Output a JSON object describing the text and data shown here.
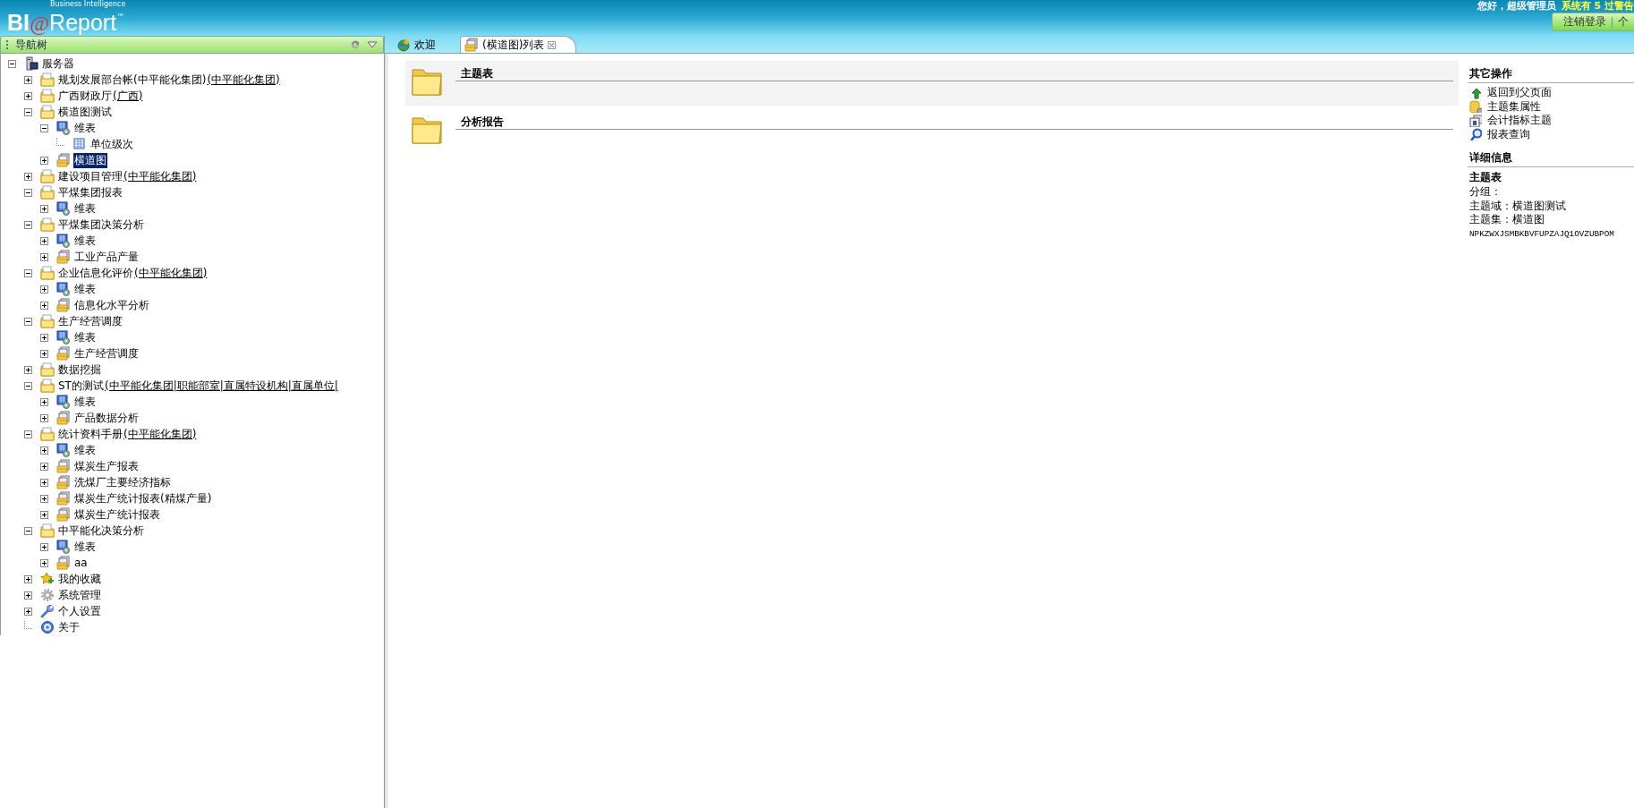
{
  "header": {
    "logo": {
      "tagline": "Business Intelligence",
      "main": "BI",
      "at": "@",
      "product": "Report",
      "tm": "™"
    },
    "greeting": "您好，超级管理员",
    "notice": "系统有 5 过警告",
    "buttons": [
      "注销登录",
      "个"
    ]
  },
  "nav": {
    "title": "导航树",
    "tree": [
      {
        "label": "服务器",
        "kind": "server",
        "expanded": true,
        "selected": false,
        "children": [
          {
            "label": "规划发展部台帐(中平能化集团)",
            "link": "(中平能化集团)",
            "kind": "folder",
            "expanded": false,
            "selected": false
          },
          {
            "label": "广西财政厅",
            "link": "(广西)",
            "kind": "folder",
            "expanded": false,
            "selected": false
          },
          {
            "label": "横道图测试",
            "kind": "folder",
            "expanded": true,
            "selected": false,
            "children": [
              {
                "label": "维表",
                "kind": "cube",
                "expanded": true,
                "selected": false,
                "children": [
                  {
                    "label": "单位级次",
                    "kind": "table",
                    "selected": false
                  }
                ]
              },
              {
                "label": "横道图",
                "kind": "report",
                "expanded": false,
                "selected": true
              }
            ]
          },
          {
            "label": "建设项目管理",
            "link": "(中平能化集团)",
            "kind": "folder",
            "expanded": false,
            "selected": false
          },
          {
            "label": "平煤集团报表",
            "kind": "folder",
            "expanded": true,
            "selected": false,
            "children": [
              {
                "label": "维表",
                "kind": "cube",
                "expanded": false,
                "selected": false
              }
            ]
          },
          {
            "label": "平煤集团决策分析",
            "kind": "folder",
            "expanded": true,
            "selected": false,
            "children": [
              {
                "label": "维表",
                "kind": "cube",
                "expanded": false,
                "selected": false
              },
              {
                "label": "工业产品产量",
                "kind": "report",
                "expanded": false,
                "selected": false
              }
            ]
          },
          {
            "label": "企业信息化评价",
            "link": "(中平能化集团)",
            "kind": "folder",
            "expanded": true,
            "selected": false,
            "children": [
              {
                "label": "维表",
                "kind": "cube",
                "expanded": false,
                "selected": false
              },
              {
                "label": "信息化水平分析",
                "kind": "report",
                "expanded": false,
                "selected": false
              }
            ]
          },
          {
            "label": "生产经营调度",
            "kind": "folder",
            "expanded": true,
            "selected": false,
            "children": [
              {
                "label": "维表",
                "kind": "cube",
                "expanded": false,
                "selected": false
              },
              {
                "label": "生产经营调度",
                "kind": "report",
                "expanded": false,
                "selected": false
              }
            ]
          },
          {
            "label": "数据挖掘",
            "kind": "folder",
            "expanded": false,
            "selected": false
          },
          {
            "label": "ST的测试",
            "link": "(中平能化集团|职能部室|直属特设机构|直属单位|",
            "kind": "folder",
            "expanded": true,
            "selected": false,
            "children": [
              {
                "label": "维表",
                "kind": "cube",
                "expanded": false,
                "selected": false
              },
              {
                "label": "产品数据分析",
                "kind": "report",
                "expanded": false,
                "selected": false
              }
            ]
          },
          {
            "label": "统计资料手册",
            "link": "(中平能化集团)",
            "kind": "folder",
            "expanded": true,
            "selected": false,
            "children": [
              {
                "label": "维表",
                "kind": "cube",
                "expanded": false,
                "selected": false
              },
              {
                "label": "煤炭生产报表",
                "kind": "report",
                "expanded": false,
                "selected": false
              },
              {
                "label": "洗煤厂主要经济指标",
                "kind": "report",
                "expanded": false,
                "selected": false
              },
              {
                "label": "煤炭生产统计报表(精煤产量)",
                "kind": "report",
                "expanded": false,
                "selected": false
              },
              {
                "label": "煤炭生产统计报表",
                "kind": "report",
                "expanded": false,
                "selected": false
              }
            ]
          },
          {
            "label": "中平能化决策分析",
            "kind": "folder",
            "expanded": true,
            "selected": false,
            "children": [
              {
                "label": "维表",
                "kind": "cube",
                "expanded": false,
                "selected": false
              },
              {
                "label": "aa",
                "kind": "report",
                "expanded": false,
                "selected": false
              }
            ]
          },
          {
            "label": "我的收藏",
            "kind": "star",
            "expanded": false,
            "selected": false
          },
          {
            "label": "系统管理",
            "kind": "gear",
            "expanded": false,
            "selected": false
          },
          {
            "label": "个人设置",
            "kind": "wrench",
            "expanded": false,
            "selected": false
          },
          {
            "label": "关于",
            "kind": "help",
            "selected": false
          }
        ]
      }
    ]
  },
  "tabs": [
    {
      "label": "欢迎",
      "kind": "globe",
      "selected": false,
      "closable": false
    },
    {
      "label": "(横道图)列表",
      "kind": "report",
      "selected": true,
      "closable": true
    }
  ],
  "content": {
    "items": [
      {
        "title": "主题表",
        "selected": true
      },
      {
        "title": "分析报告",
        "selected": false
      }
    ]
  },
  "side": {
    "ops_title": "其它操作",
    "actions": [
      {
        "label": "返回到父页面",
        "kind": "back"
      },
      {
        "label": "主题集属性",
        "kind": "dbgear"
      },
      {
        "label": "会计指标主题",
        "kind": "windows"
      },
      {
        "label": "报表查询",
        "kind": "search"
      }
    ],
    "details_title": "详细信息",
    "detail_name": "主题表",
    "lines": [
      "分组：",
      "主题域：横道图测试",
      "主题集：横道图"
    ],
    "code": "NPKZWXJSMBKBVFUPZAJQ1OVZUBPOM"
  }
}
